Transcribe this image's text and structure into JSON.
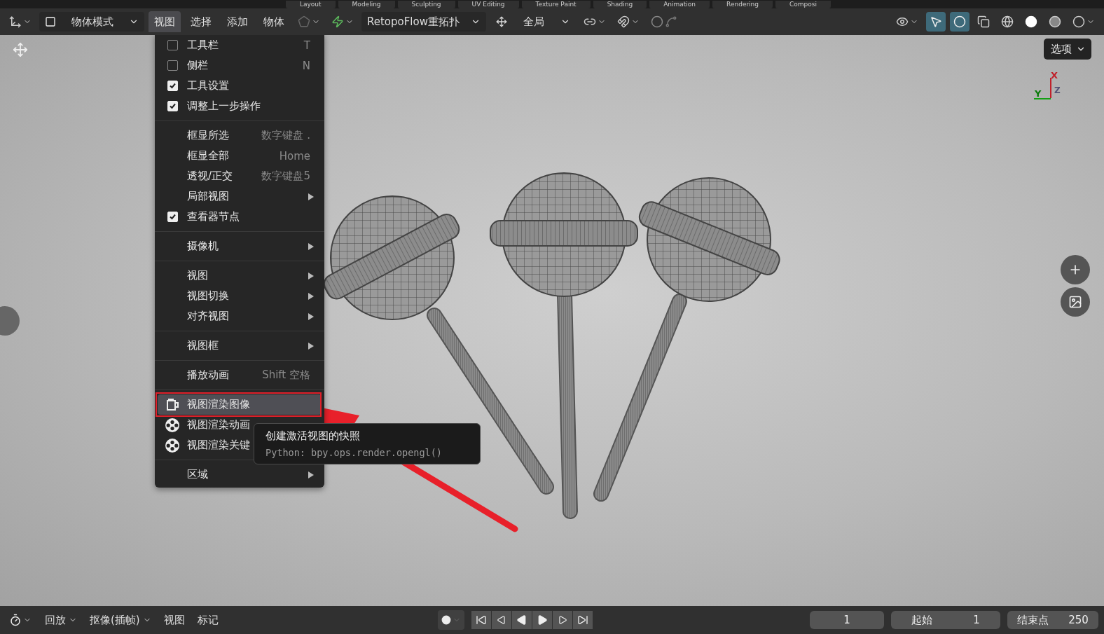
{
  "workspace_tabs": [
    "Layout",
    "Modeling",
    "Sculpting",
    "UV Editing",
    "Texture Paint",
    "Shading",
    "Animation",
    "Rendering",
    "Composi"
  ],
  "header": {
    "mode": "物体模式",
    "menus": [
      {
        "label": "视图",
        "selected": true
      },
      {
        "label": "选择",
        "selected": false
      },
      {
        "label": "添加",
        "selected": false
      },
      {
        "label": "物体",
        "selected": false
      }
    ],
    "addon_menu": "RetopoFlow重拓扑",
    "orientation": "全局"
  },
  "viewport": {
    "options_button": "选项",
    "gizmo_labels": [
      "X",
      "Y",
      "Z"
    ]
  },
  "view_menu": {
    "sections": [
      [
        {
          "kind": "toggle",
          "label": "工具栏",
          "checked": false,
          "shortcut": "T",
          "selected": false
        },
        {
          "kind": "toggle",
          "label": "侧栏",
          "checked": false,
          "shortcut": "N",
          "selected": false
        },
        {
          "kind": "toggle",
          "label": "工具设置",
          "checked": true,
          "selected": false
        },
        {
          "kind": "toggle",
          "label": "调整上一步操作",
          "checked": true,
          "selected": false
        }
      ],
      [
        {
          "kind": "action",
          "label": "框显所选",
          "shortcut": "数字键盘 .",
          "selected": false
        },
        {
          "kind": "action",
          "label": "框显全部",
          "shortcut": "Home",
          "selected": false
        },
        {
          "kind": "action",
          "label": "透视/正交",
          "shortcut": "数字键盘5",
          "selected": false
        },
        {
          "kind": "submenu",
          "label": "局部视图",
          "selected": false
        },
        {
          "kind": "toggle",
          "label": "查看器节点",
          "checked": true,
          "selected": false
        }
      ],
      [
        {
          "kind": "submenu",
          "label": "摄像机",
          "selected": false
        }
      ],
      [
        {
          "kind": "submenu",
          "label": "视图",
          "selected": false
        },
        {
          "kind": "submenu",
          "label": "视图切换",
          "selected": false
        },
        {
          "kind": "submenu",
          "label": "对齐视图",
          "selected": false
        }
      ],
      [
        {
          "kind": "submenu",
          "label": "视图框",
          "selected": false
        }
      ],
      [
        {
          "kind": "action",
          "label": "播放动画",
          "shortcut": "Shift 空格",
          "selected": false
        }
      ],
      [
        {
          "kind": "render_image",
          "label": "视图渲染图像",
          "selected": true
        },
        {
          "kind": "render_sequence",
          "label": "视图渲染动画",
          "selected": false
        },
        {
          "kind": "render_sequence",
          "label": "视图渲染关键",
          "selected": false
        }
      ],
      [
        {
          "kind": "submenu",
          "label": "区域",
          "selected": false
        }
      ]
    ]
  },
  "tooltip": {
    "title": "创建激活视图的快照",
    "python": "Python: bpy.ops.render.opengl()"
  },
  "timeline": {
    "menus": [
      "回放",
      "抠像(插帧)",
      "视图",
      "标记"
    ],
    "current_frame": "1",
    "start_label": "起始",
    "start": "1",
    "end_label": "结束点",
    "end": "250"
  }
}
